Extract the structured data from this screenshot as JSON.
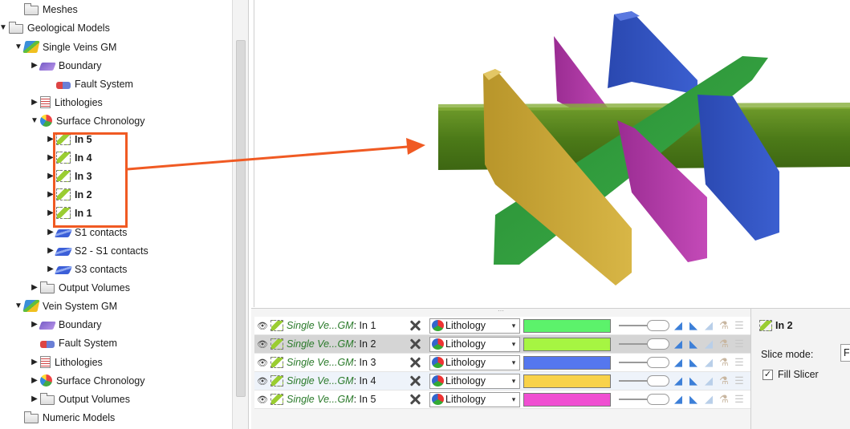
{
  "tree": {
    "items": [
      {
        "label": "Meshes",
        "icon": "folder-icon",
        "arrow": "",
        "bold": false
      },
      {
        "label": "Geological Models",
        "icon": "folder-icon",
        "arrow": "▼",
        "bold": false
      },
      {
        "label": "Single Veins GM",
        "icon": "geological-model-icon",
        "arrow": "▼",
        "bold": false
      },
      {
        "label": "Boundary",
        "icon": "boundary-icon",
        "arrow": "▶",
        "bold": false
      },
      {
        "label": "Fault System",
        "icon": "fault-system-icon",
        "arrow": "",
        "bold": false
      },
      {
        "label": "Lithologies",
        "icon": "lithologies-icon",
        "arrow": "▶",
        "bold": false
      },
      {
        "label": "Surface Chronology",
        "icon": "surface-chronology-icon",
        "arrow": "▼",
        "bold": false
      },
      {
        "label": "In 5",
        "icon": "intrusion-icon",
        "arrow": "▶",
        "bold": true
      },
      {
        "label": "In 4",
        "icon": "intrusion-icon",
        "arrow": "▶",
        "bold": true
      },
      {
        "label": "In 3",
        "icon": "intrusion-icon",
        "arrow": "▶",
        "bold": true
      },
      {
        "label": "In 2",
        "icon": "intrusion-icon",
        "arrow": "▶",
        "bold": true
      },
      {
        "label": "In 1",
        "icon": "intrusion-icon",
        "arrow": "▶",
        "bold": true
      },
      {
        "label": "S1 contacts",
        "icon": "contacts-icon",
        "arrow": "▶",
        "bold": false
      },
      {
        "label": "S2 - S1 contacts",
        "icon": "contacts-icon",
        "arrow": "▶",
        "bold": false
      },
      {
        "label": "S3 contacts",
        "icon": "contacts-icon",
        "arrow": "▶",
        "bold": false
      },
      {
        "label": "Output Volumes",
        "icon": "folder-icon",
        "arrow": "▶",
        "bold": false
      },
      {
        "label": "Vein System GM",
        "icon": "geological-model-icon",
        "arrow": "▼",
        "bold": false
      },
      {
        "label": "Boundary",
        "icon": "boundary-icon",
        "arrow": "▶",
        "bold": false
      },
      {
        "label": "Fault System",
        "icon": "fault-system-icon",
        "arrow": "",
        "bold": false
      },
      {
        "label": "Lithologies",
        "icon": "lithologies-icon",
        "arrow": "▶",
        "bold": false
      },
      {
        "label": "Surface Chronology",
        "icon": "surface-chronology-icon",
        "arrow": "▶",
        "bold": false
      },
      {
        "label": "Output Volumes",
        "icon": "folder-icon",
        "arrow": "▶",
        "bold": false
      },
      {
        "label": "Numeric Models",
        "icon": "folder-icon",
        "arrow": "",
        "bold": false
      }
    ]
  },
  "annotation": {
    "color": "#f05a23"
  },
  "scene_list": {
    "rows": [
      {
        "model": "Single Ve...GM",
        "object": ": In 1",
        "colour_mode": "Lithology",
        "colour": "#5cf26b",
        "selected": false
      },
      {
        "model": "Single Ve...GM",
        "object": ": In 2",
        "colour_mode": "Lithology",
        "colour": "#a6f542",
        "selected": true
      },
      {
        "model": "Single Ve...GM",
        "object": ": In 3",
        "colour_mode": "Lithology",
        "colour": "#5577ee",
        "selected": false
      },
      {
        "model": "Single Ve...GM",
        "object": ": In 4",
        "colour_mode": "Lithology",
        "colour": "#f8d24a",
        "selected": false
      },
      {
        "model": "Single Ve...GM",
        "object": ": In 5",
        "colour_mode": "Lithology",
        "colour": "#f04fd2",
        "selected": false
      }
    ]
  },
  "properties": {
    "title": "In 2",
    "slice_mode_label": "Slice mode:",
    "slice_mode_value": "Fr",
    "fill_slicer_label": "Fill Slicer",
    "fill_slicer_checked": true
  },
  "viewport": {
    "vein_colors": {
      "green_horizontal": "#4f7d1a",
      "green_diagonal": "#2f9a3a",
      "yellow": "#c9a531",
      "magenta": "#b63dab",
      "blue": "#2f4fba"
    }
  }
}
